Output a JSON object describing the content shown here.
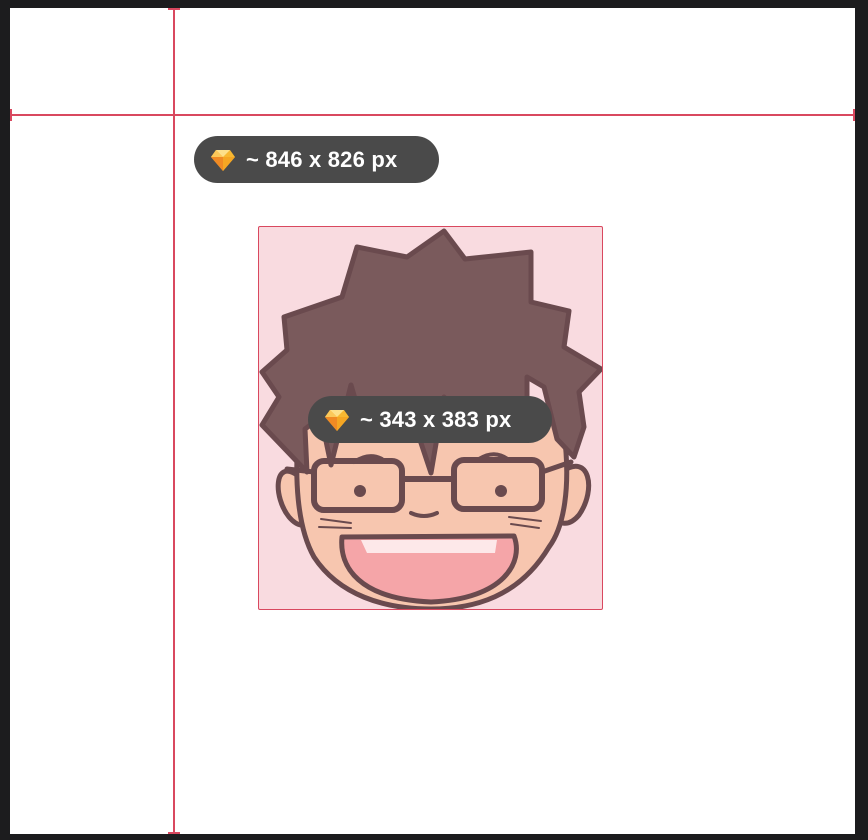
{
  "measurements": {
    "canvas_size_label": "~ 846 x 826 px",
    "avatar_size_label": "~ 343 x 383 px"
  },
  "icons": {
    "size_badge_icon": "sketch-diamond-icon"
  },
  "colors": {
    "guide_line": "#d9485f",
    "selection_fill": "#f9dbe0",
    "pill_background": "#4a4a4a",
    "hair": "#7a5a5c",
    "outline": "#6a4a4e",
    "skin": "#f7c6af",
    "mouth": "#f5a5a8"
  }
}
